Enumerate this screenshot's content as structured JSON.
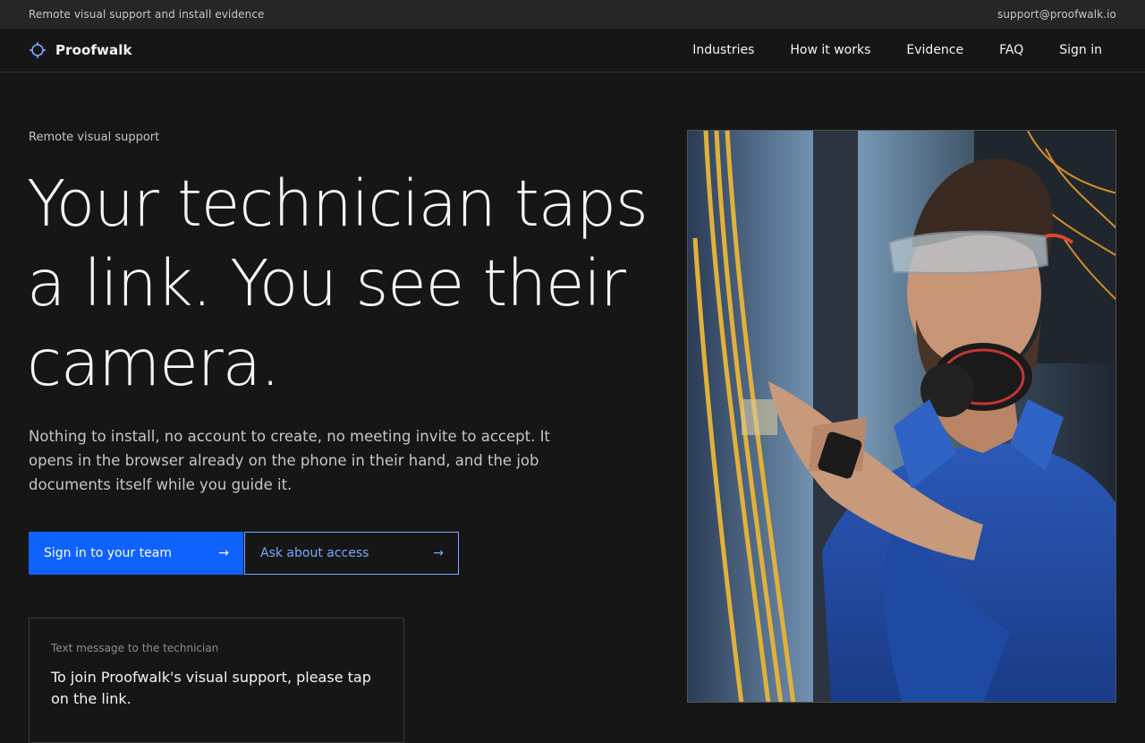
{
  "topbar": {
    "tagline": "Remote visual support and install evidence",
    "email": "support@proofwalk.io"
  },
  "nav": {
    "brand": "Proofwalk",
    "logo_icon": "crosshair-icon",
    "links": [
      "Industries",
      "How it works",
      "Evidence",
      "FAQ",
      "Sign in"
    ]
  },
  "hero": {
    "eyebrow": "Remote visual support",
    "headline": "Your technician taps a link. You see their camera.",
    "lede": "Nothing to install, no account to create, no meeting invite to accept. It opens in the browser already on the phone in their hand, and the job documents itself while you guide it.",
    "primary_cta": "Sign in to your team",
    "secondary_cta": "Ask about access",
    "cta_icon": "arrow-right-icon"
  },
  "sms": {
    "label": "Text message to the technician",
    "body": "To join Proofwalk's visual support, please tap on the link."
  },
  "image": {
    "alt_subject": "technician with safety glasses and ear defenders working on fiber cabling",
    "accent_color": "#0f62fe",
    "link_color": "#78a9ff",
    "background": "#161616"
  }
}
